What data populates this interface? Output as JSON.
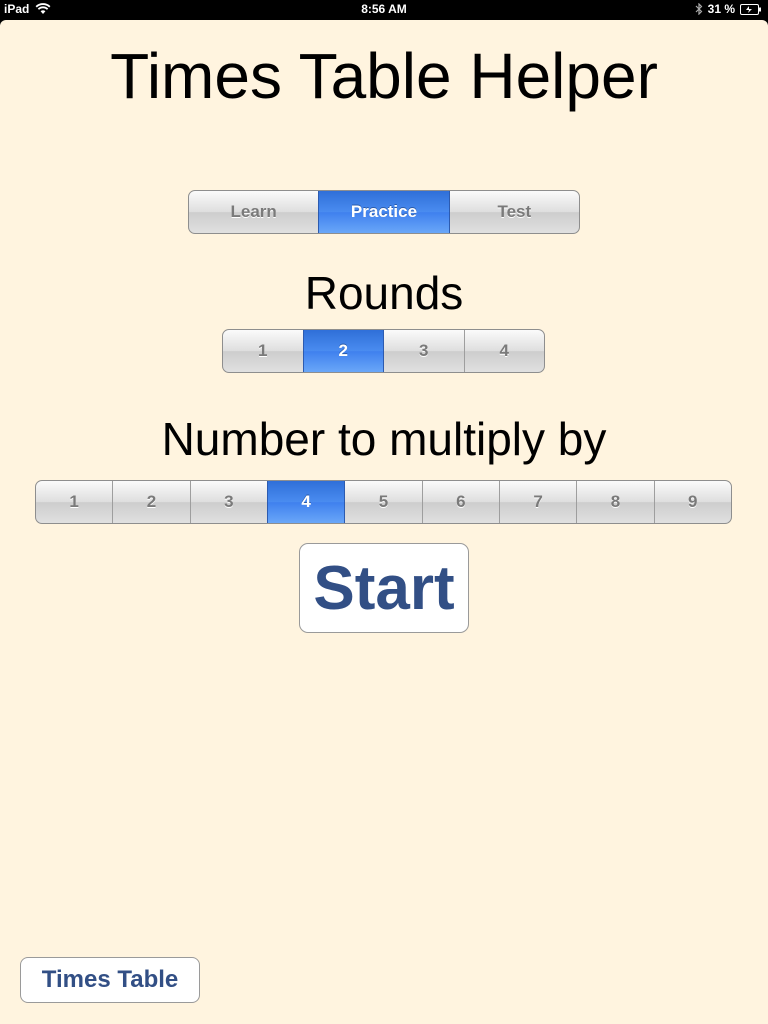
{
  "status_bar": {
    "device": "iPad",
    "time": "8:56 AM",
    "battery": "31 %",
    "icons": [
      "wifi-icon",
      "bluetooth-icon",
      "battery-icon"
    ]
  },
  "title": "Times Table Helper",
  "mode": {
    "options": [
      "Learn",
      "Practice",
      "Test"
    ],
    "selected": "Practice"
  },
  "rounds": {
    "heading": "Rounds",
    "options": [
      "1",
      "2",
      "3",
      "4"
    ],
    "selected": "2"
  },
  "multiplier": {
    "heading": "Number to multiply by",
    "options": [
      "1",
      "2",
      "3",
      "4",
      "5",
      "6",
      "7",
      "8",
      "9"
    ],
    "selected": "4"
  },
  "start_label": "Start",
  "times_table_label": "Times Table",
  "colors": {
    "background": "#fff4df",
    "selected_segment": "#3f80ee",
    "button_text": "#324f85"
  }
}
